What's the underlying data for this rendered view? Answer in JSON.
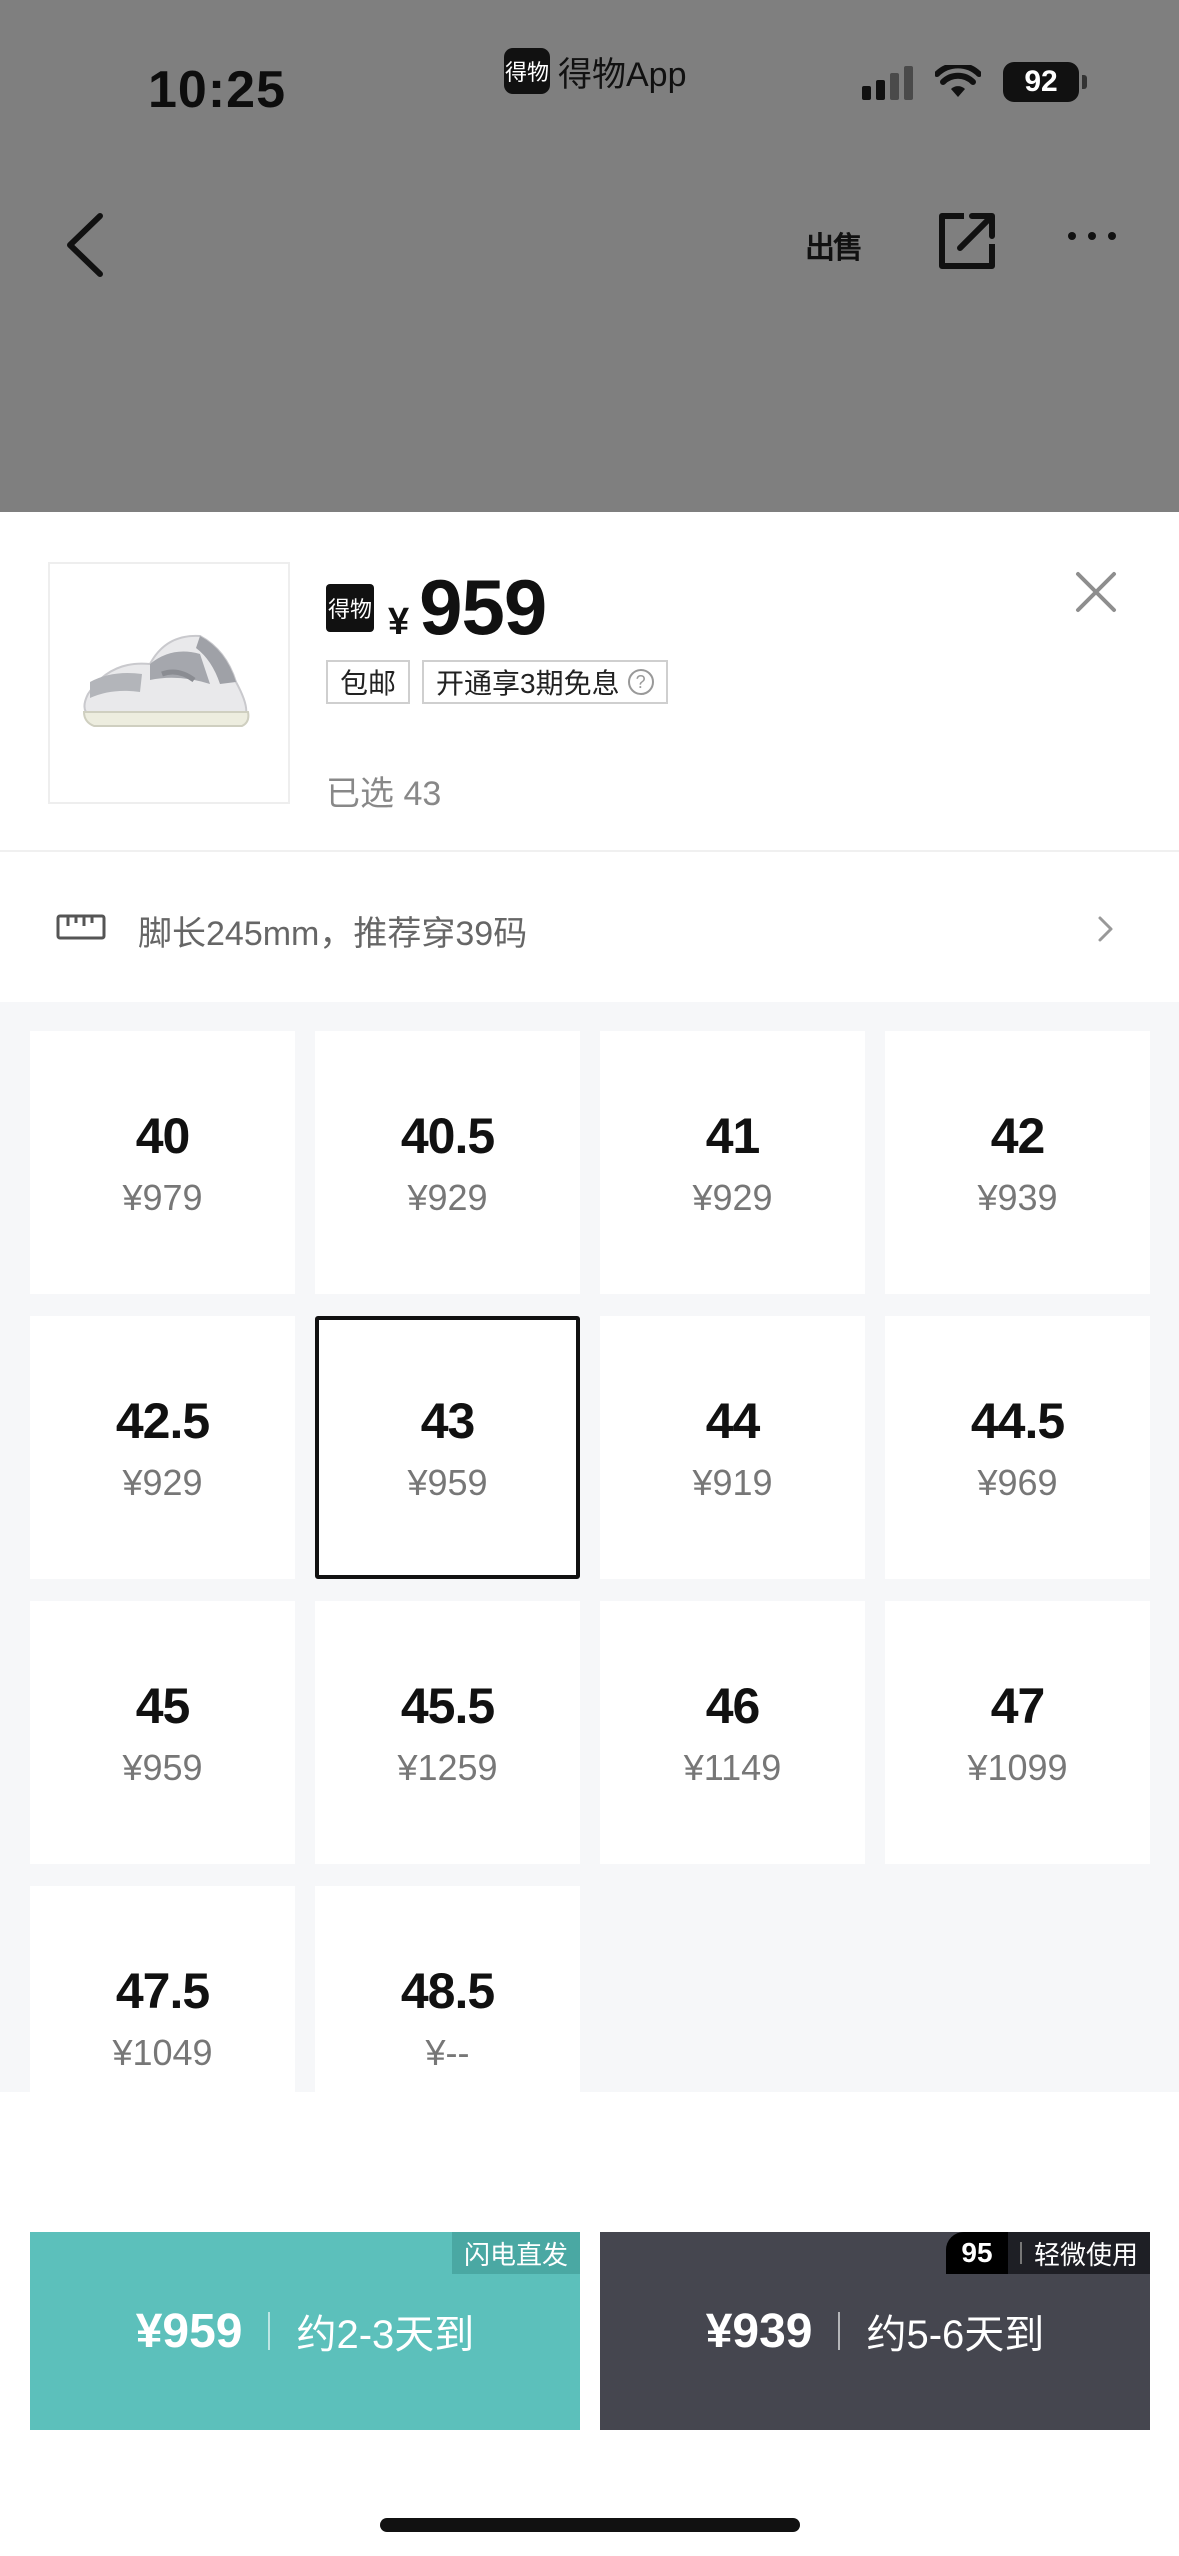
{
  "status_bar": {
    "time": "10:25",
    "app_name": "得物App",
    "app_logo": "得物",
    "battery": "92"
  },
  "nav": {
    "sell_label": "出售"
  },
  "product": {
    "brand_logo": "得物",
    "currency": "¥",
    "price": "959",
    "tags": [
      "包邮",
      "开通享3期免息"
    ],
    "help_icon": "?",
    "selected_text": "已选 43"
  },
  "size_guide": {
    "text": "脚长245mm，推荐穿39码"
  },
  "sizes": [
    {
      "size": "40",
      "price": "¥979"
    },
    {
      "size": "40.5",
      "price": "¥929"
    },
    {
      "size": "41",
      "price": "¥929"
    },
    {
      "size": "42",
      "price": "¥939"
    },
    {
      "size": "42.5",
      "price": "¥929"
    },
    {
      "size": "43",
      "price": "¥959",
      "selected": true
    },
    {
      "size": "44",
      "price": "¥919"
    },
    {
      "size": "44.5",
      "price": "¥969"
    },
    {
      "size": "45",
      "price": "¥959"
    },
    {
      "size": "45.5",
      "price": "¥1259"
    },
    {
      "size": "46",
      "price": "¥1149"
    },
    {
      "size": "47",
      "price": "¥1099"
    },
    {
      "size": "47.5",
      "price": "¥1049"
    },
    {
      "size": "48.5",
      "price": "¥--"
    }
  ],
  "buttons": {
    "fast": {
      "price": "¥959",
      "delivery": "约2-3天到",
      "tag": "闪电直发"
    },
    "slow": {
      "price": "¥939",
      "delivery": "约5-6天到",
      "grade": "95",
      "tag": "轻微使用"
    }
  },
  "colors": {
    "fast_button": "#5cc0bb",
    "slow_button": "#45464f",
    "overlay": "#7f7f7f"
  }
}
